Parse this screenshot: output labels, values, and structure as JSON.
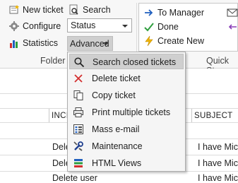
{
  "ribbon": {
    "new_ticket": "New ticket",
    "search": "Search",
    "configure": "Configure",
    "status_select": "Status",
    "statistics": "Statistics",
    "advanced": "Advanced",
    "folder_group": "Folder l",
    "quick_steps": {
      "to_manager": "To Manager",
      "done": "Done",
      "create_new": "Create New",
      "group_label": "Quick Ste"
    }
  },
  "advanced_menu": {
    "items": [
      {
        "label": "Search closed tickets",
        "icon": "search-icon",
        "highlighted": true
      },
      {
        "label": "Delete ticket",
        "icon": "red-x-icon"
      },
      {
        "label": "Copy ticket",
        "icon": "copy-icon"
      },
      {
        "label": "Print multiple tickets",
        "icon": "printer-icon"
      },
      {
        "label": "Mass e-mail",
        "icon": "mass-email-icon"
      },
      {
        "label": "Maintenance",
        "icon": "tools-icon"
      },
      {
        "label": "HTML Views",
        "icon": "html-views-icon"
      }
    ]
  },
  "grid": {
    "columns": [
      "INCI",
      "SUBJECT"
    ],
    "rows": [
      {
        "left": "Delete",
        "right": "I have Micro"
      },
      {
        "left": "Delete",
        "right": "I have Micro"
      },
      {
        "left": "Delete user",
        "right": "I have Micro"
      }
    ]
  },
  "colors": {
    "ribbon_bg": "#f7f7f7",
    "menu_highlight": "#cfcfcf",
    "accent_blue": "#1f5fbf"
  }
}
